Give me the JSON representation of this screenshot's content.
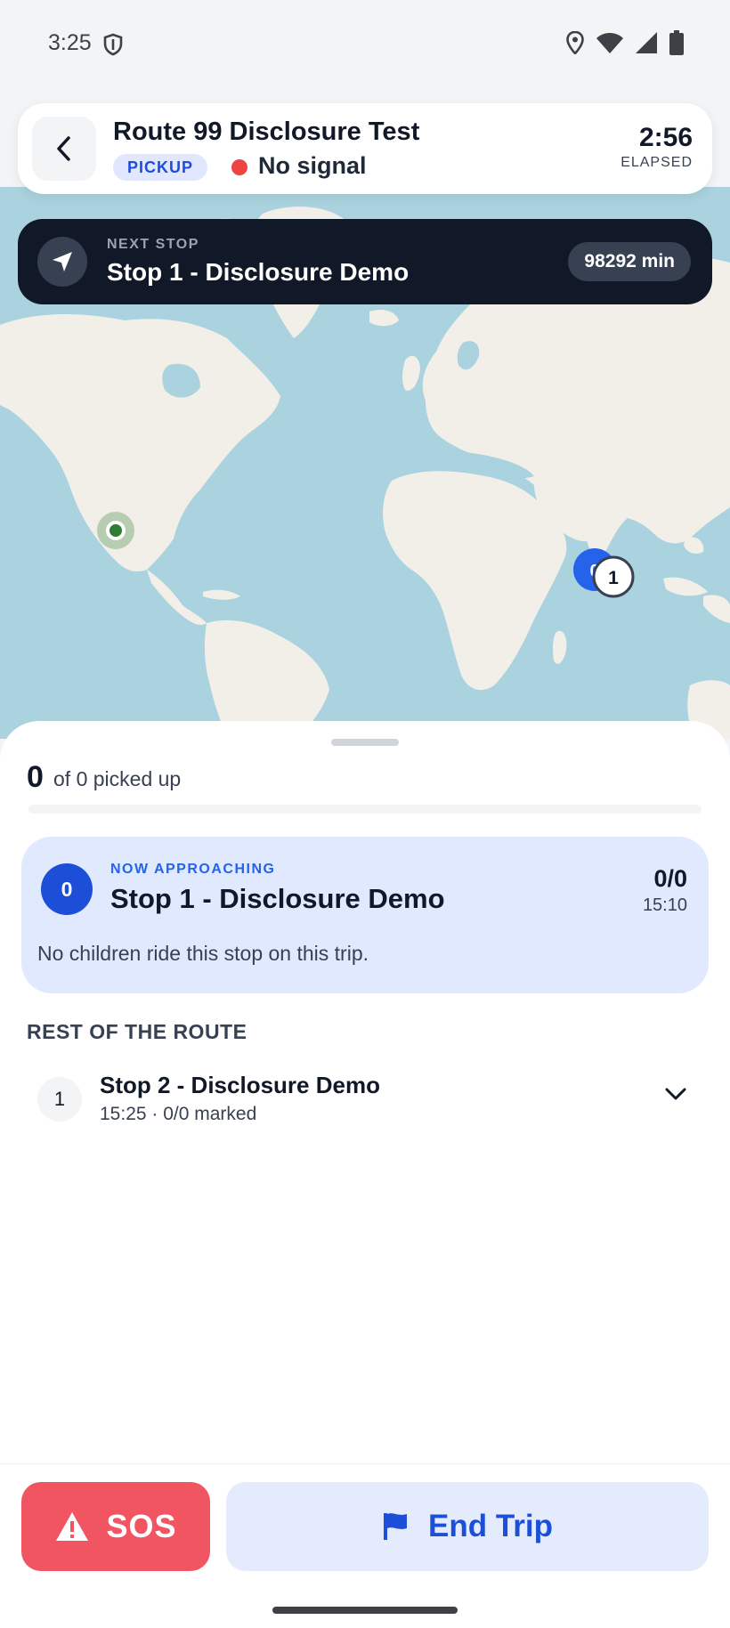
{
  "status_bar": {
    "time": "3:25"
  },
  "header": {
    "title": "Route 99 Disclosure Test",
    "badge": "PICKUP",
    "signal": "No signal",
    "elapsed_time": "2:56",
    "elapsed_label": "ELAPSED"
  },
  "next_stop": {
    "label": "NEXT STOP",
    "name": "Stop 1 - Disclosure Demo",
    "eta": "98292 min"
  },
  "map": {
    "stop_marker_label": "0",
    "stop_cluster_label": "1"
  },
  "progress": {
    "picked_up": "0",
    "summary": "of 0 picked up",
    "fraction": 0
  },
  "approaching": {
    "label": "NOW APPROACHING",
    "stop_number": "0",
    "name": "Stop 1 - Disclosure Demo",
    "count": "0/0",
    "time": "15:10",
    "note": "No children ride this stop on this trip."
  },
  "rest_of_route": {
    "heading": "REST OF THE ROUTE",
    "items": [
      {
        "number": "1",
        "name": "Stop 2 - Disclosure Demo",
        "meta": "15:25 · 0/0 marked"
      }
    ]
  },
  "actions": {
    "sos_label": "SOS",
    "end_trip_label": "End Trip"
  },
  "colors": {
    "primary": "#1d4ed8",
    "sos": "#f25562",
    "map_water": "#aad3df",
    "map_land": "#f2efe9",
    "signal_off": "#ef4444"
  },
  "icons": [
    "back-chevron-icon",
    "navigation-arrow-icon",
    "warning-triangle-icon",
    "flag-icon",
    "chevron-down-icon",
    "location-pin-icon",
    "wifi-icon",
    "cell-signal-icon",
    "battery-icon",
    "shield-icon"
  ]
}
